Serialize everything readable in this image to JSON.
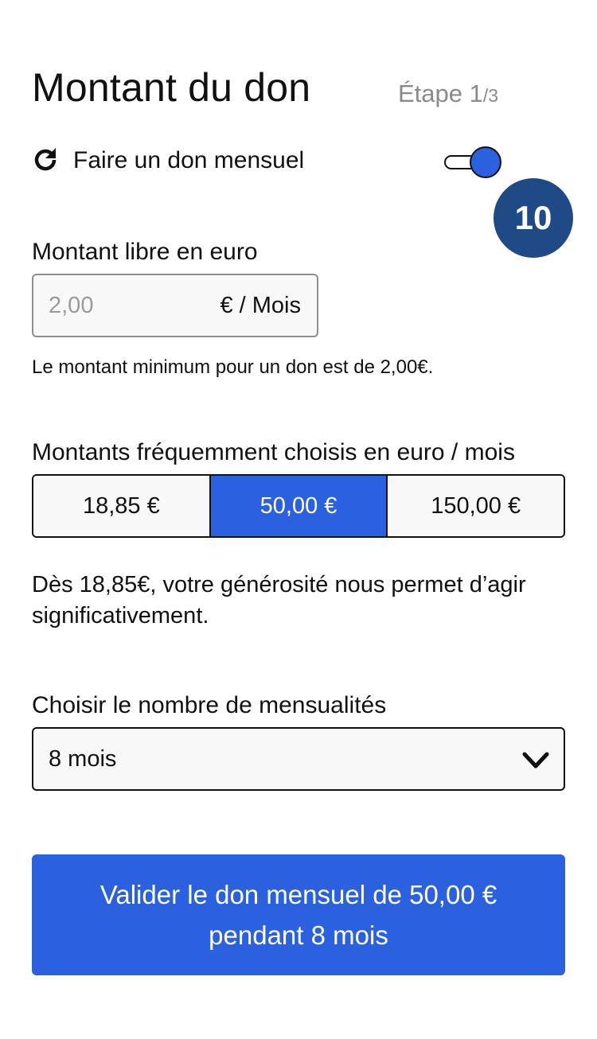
{
  "header": {
    "title": "Montant du don",
    "step_prefix": "Étape 1",
    "step_suffix": "/3"
  },
  "monthly": {
    "label": "Faire un don mensuel",
    "toggle_on": true,
    "icon": "refresh-icon"
  },
  "badge": {
    "value": "10"
  },
  "free_amount": {
    "label": "Montant libre en euro",
    "placeholder": "2,00",
    "suffix": "€ / Mois",
    "hint": "Le montant minimum pour un don est de 2,00€."
  },
  "frequent": {
    "label": "Montants fréquemment choisis en euro / mois",
    "options": [
      {
        "label": "18,85 €",
        "selected": false
      },
      {
        "label": "50,00 €",
        "selected": true
      },
      {
        "label": "150,00 €",
        "selected": false
      }
    ],
    "message": "Dès 18,85€, votre générosité nous permet d’agir significativement."
  },
  "installments": {
    "label": "Choisir le nombre de mensualités",
    "selected": "8 mois",
    "icon": "chevron-down-icon"
  },
  "submit": {
    "line1": "Valider le don mensuel de 50,00 €",
    "line2": "pendant 8 mois"
  },
  "colors": {
    "accent": "#2b61df",
    "badge": "#1f4a86",
    "muted": "#8a8a8a"
  }
}
